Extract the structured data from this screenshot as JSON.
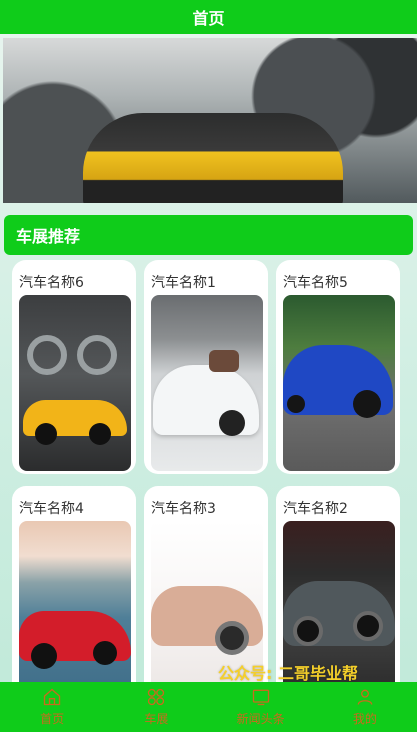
{
  "header": {
    "title": "首页"
  },
  "section": {
    "title": "车展推荐"
  },
  "cars": [
    {
      "name": "汽车名称6"
    },
    {
      "name": "汽车名称1"
    },
    {
      "name": "汽车名称5"
    },
    {
      "name": "汽车名称4"
    },
    {
      "name": "汽车名称3"
    },
    {
      "name": "汽车名称2"
    }
  ],
  "nav": [
    {
      "label": "首页",
      "icon": "home-icon"
    },
    {
      "label": "车展",
      "icon": "grid-icon"
    },
    {
      "label": "新闻头条",
      "icon": "news-icon"
    },
    {
      "label": "我的",
      "icon": "person-icon"
    }
  ],
  "watermark": "公众号: 二哥毕业帮",
  "colors": {
    "accent": "#0fcc1a",
    "nav_text": "#c86b1e"
  }
}
